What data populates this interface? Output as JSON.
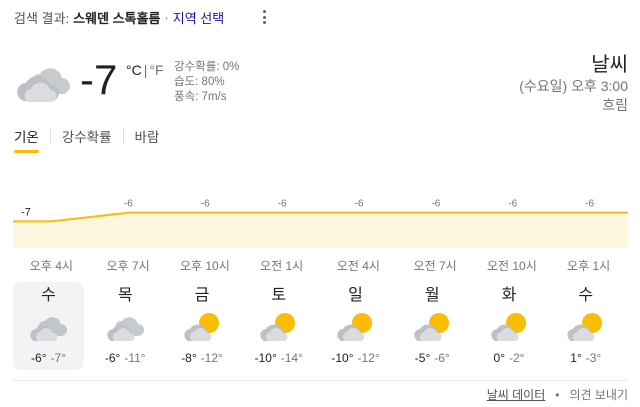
{
  "header": {
    "prefix": "검색 결과:",
    "location": "스웨덴 스톡홀름",
    "separator": "·",
    "select_location": "지역 선택"
  },
  "current": {
    "icon": "cloudy-icon",
    "temperature": "-7",
    "unit_c": "°C",
    "unit_sep": "|",
    "unit_f": "°F",
    "precipitation": "강수확률: 0%",
    "humidity": "습도: 80%",
    "wind": "풍속: 7m/s"
  },
  "info": {
    "title": "날씨",
    "datetime": "(수요일) 오후 3:00",
    "condition": "흐림"
  },
  "tabs": [
    {
      "label": "기온",
      "active": true
    },
    {
      "label": "강수확률",
      "active": false
    },
    {
      "label": "바람",
      "active": false
    }
  ],
  "chart_data": {
    "type": "area",
    "x": [
      "오후 4시",
      "오후 7시",
      "오후 10시",
      "오전 1시",
      "오전 4시",
      "오전 7시",
      "오전 10시",
      "오후 1시"
    ],
    "data_labels": [
      "-7",
      "-6",
      "-6",
      "-6",
      "-6",
      "-6",
      "-6",
      "-6"
    ],
    "values": [
      -7,
      -6,
      -6,
      -6,
      -6,
      -6,
      -6,
      -6
    ],
    "fill_color": "#fef7e0",
    "line_color": "#fbbc04"
  },
  "forecast": {
    "times": [
      "오후 4시",
      "오후 7시",
      "오후 10시",
      "오전 1시",
      "오전 4시",
      "오전 7시",
      "오전 10시",
      "오후 1시"
    ],
    "days": [
      {
        "name": "수",
        "icon": "cloudy-icon",
        "high": "-6°",
        "low": "-7°",
        "selected": true
      },
      {
        "name": "목",
        "icon": "cloudy-icon",
        "high": "-6°",
        "low": "-11°",
        "selected": false
      },
      {
        "name": "금",
        "icon": "partly-cloudy-icon",
        "high": "-8°",
        "low": "-12°",
        "selected": false
      },
      {
        "name": "토",
        "icon": "partly-cloudy-icon",
        "high": "-10°",
        "low": "-14°",
        "selected": false
      },
      {
        "name": "일",
        "icon": "partly-cloudy-icon",
        "high": "-10°",
        "low": "-12°",
        "selected": false
      },
      {
        "name": "월",
        "icon": "partly-cloudy-icon",
        "high": "-5°",
        "low": "-6°",
        "selected": false
      },
      {
        "name": "화",
        "icon": "partly-cloudy-icon",
        "high": "0°",
        "low": "-2°",
        "selected": false
      },
      {
        "name": "수",
        "icon": "partly-cloudy-icon",
        "high": "1°",
        "low": "-3°",
        "selected": false
      }
    ]
  },
  "footer": {
    "weather_data": "날씨 데이터",
    "bullet": "•",
    "feedback": "의견 보내기"
  },
  "colors": {
    "accent": "#fbbc04",
    "link": "#1a0dab",
    "muted": "#70757a"
  }
}
